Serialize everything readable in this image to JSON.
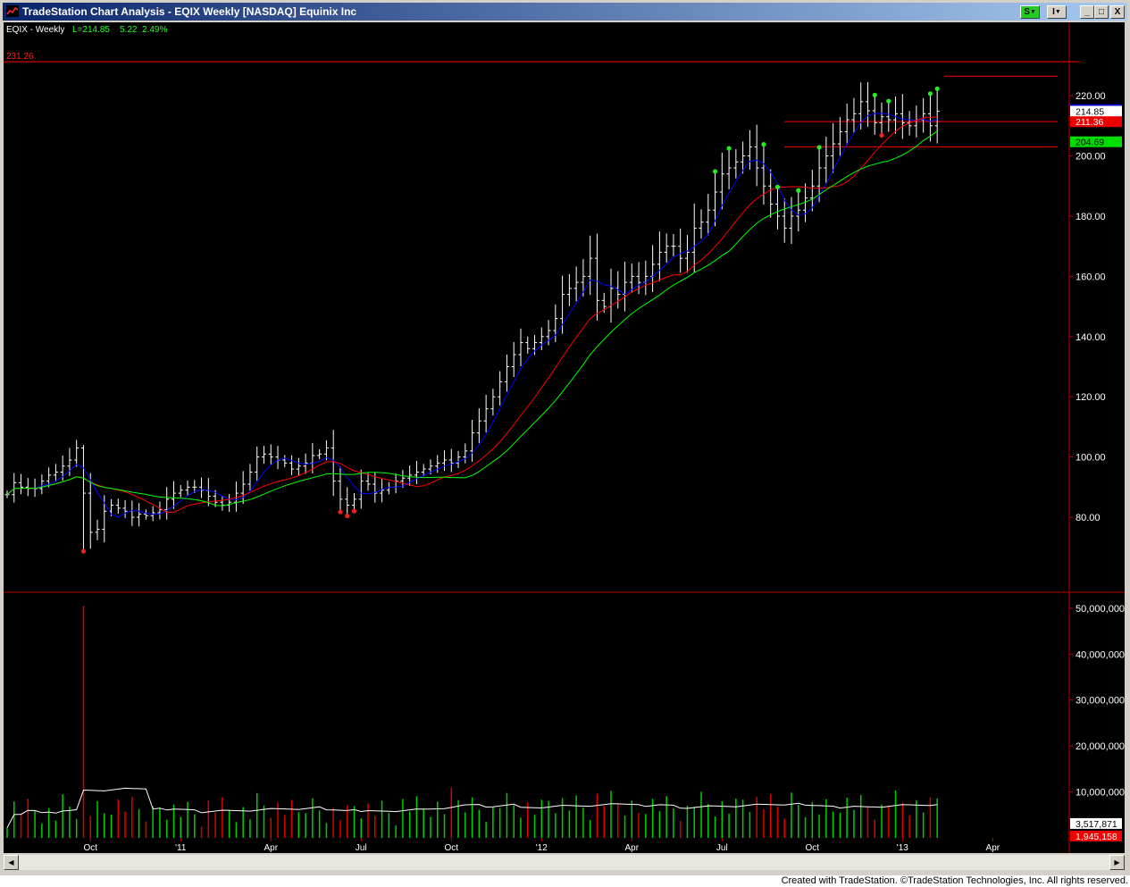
{
  "window": {
    "title": "TradeStation Chart Analysis - EQIX Weekly [NASDAQ] Equinix Inc",
    "buttons": {
      "s": "S",
      "i": "I",
      "minimize": "_",
      "maximize": "□",
      "close": "X"
    },
    "footer": "Created with TradeStation. ©TradeStation Technologies, Inc. All rights reserved."
  },
  "chart_data": {
    "type": "ohlc-bar",
    "symbol_label": "EQIX - Weekly",
    "last_label": "L=214.85",
    "change_label": "5.22",
    "percent_label": "2.49%",
    "top_line_label": "231.26",
    "price_tick_labels": [
      "220.00",
      "200.00",
      "180.00",
      "160.00",
      "140.00",
      "120.00",
      "100.00",
      "80.00"
    ],
    "price_ticks": [
      220,
      200,
      180,
      160,
      140,
      120,
      100,
      80
    ],
    "price_ylim": [
      64,
      240.5
    ],
    "volume_tick_labels": [
      "50,000,000",
      "40,000,000",
      "30,000,000",
      "20,000,000",
      "10,000,000"
    ],
    "volume_ticks": [
      50000000,
      40000000,
      30000000,
      20000000,
      10000000
    ],
    "volume_ylim": [
      0,
      52500000
    ],
    "last_price_box": "214.85",
    "red_price_box": "211.36",
    "green_price_box": "204.69",
    "vol_avg_box": "3,517,871",
    "vol_last_box": "1,945,158",
    "x_labels": [
      "Oct",
      "'11",
      "Apr",
      "Jul",
      "Oct",
      "'12",
      "Apr",
      "Jul",
      "Oct",
      "'13",
      "Apr"
    ],
    "x_label_weeks": [
      12,
      25,
      38,
      51,
      64,
      77,
      90,
      103,
      116,
      129,
      142
    ],
    "horizontal_lines": [
      {
        "price": 231.26,
        "start_week": 0,
        "color": "#ff0000"
      },
      {
        "price": 226.5,
        "start_week": 135,
        "color": "#ff0000"
      },
      {
        "price": 211.4,
        "start_week": 112,
        "color": "#ff0000"
      },
      {
        "price": 203.0,
        "start_week": 112,
        "color": "#ff0000"
      }
    ],
    "series": [
      {
        "name": "",
        "color": "#0000ff",
        "type": "average",
        "period": 5
      },
      {
        "name": "",
        "color": "#ff0000",
        "type": "average",
        "period": 13
      },
      {
        "name": "",
        "color": "#00ff00",
        "type": "average",
        "period": 20
      }
    ],
    "weekly_close": [
      87.5,
      91.5,
      90.0,
      89.5,
      89.5,
      92.0,
      94.0,
      95.0,
      97.0,
      99.0,
      103.0,
      88.0,
      75.0,
      76.0,
      82.0,
      84.0,
      83.0,
      82.0,
      80.0,
      81.0,
      80.5,
      81.5,
      82.5,
      86.0,
      88.0,
      89.0,
      90.0,
      90.0,
      89.0,
      87.0,
      85.0,
      84.0,
      85.0,
      88.0,
      91.0,
      95.0,
      100.0,
      101.0,
      100.0,
      99.0,
      98.0,
      96.0,
      97.0,
      98.0,
      100.5,
      101.0,
      103.0,
      92.0,
      86.0,
      84.0,
      86.0,
      92.0,
      91.0,
      88.0,
      89.0,
      90.0,
      92.0,
      93.0,
      94.0,
      95.0,
      96.0,
      97.0,
      98.0,
      99.0,
      98.0,
      100.0,
      102.0,
      108.0,
      112.0,
      116.0,
      120.0,
      125.0,
      130.0,
      134.0,
      138.0,
      136.0,
      138.0,
      140.0,
      142.0,
      146.0,
      154.0,
      156.0,
      158.0,
      160.0,
      166.0,
      152.0,
      150.0,
      156.0,
      154.0,
      158.0,
      160.0,
      158.0,
      160.0,
      164.0,
      168.0,
      170.0,
      170.0,
      166.0,
      168.0,
      176.0,
      178.0,
      182.0,
      188.0,
      194.0,
      196.0,
      198.0,
      200.0,
      203.0,
      196.0,
      190.0,
      184.0,
      180.0,
      176.0,
      180.0,
      182.0,
      186.0,
      190.0,
      196.0,
      200.0,
      204.0,
      208.0,
      212.0,
      214.0,
      218.0,
      215.0,
      211.0,
      213.0,
      212.0,
      214.0,
      211.0,
      210.0,
      212.0,
      214.0,
      210.0,
      214.85
    ],
    "swing_high_weeks": [
      102,
      104,
      109,
      111,
      114,
      117,
      125,
      127,
      133,
      134,
      135,
      137
    ],
    "swing_low_weeks": [
      11,
      48,
      49,
      50,
      126,
      137,
      140,
      141
    ],
    "volume_spike_week": 11,
    "volume_spike_value": 50500000
  }
}
